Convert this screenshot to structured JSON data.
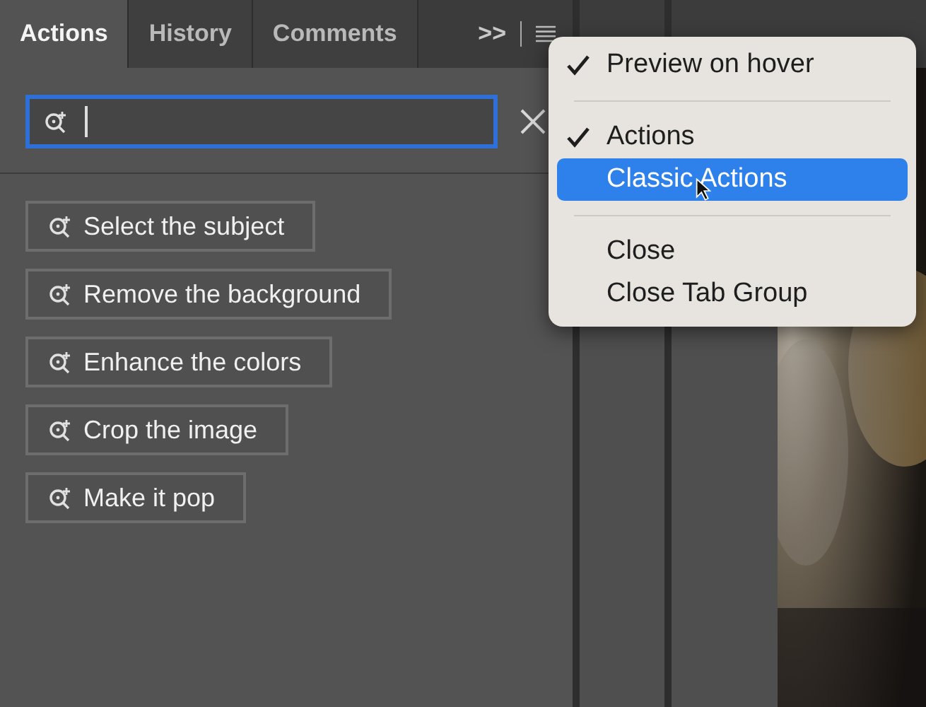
{
  "panel": {
    "tabs": [
      {
        "label": "Actions",
        "selected": true
      },
      {
        "label": "History",
        "selected": false
      },
      {
        "label": "Comments",
        "selected": false
      }
    ],
    "overflow": ">>",
    "search": {
      "focused": true
    },
    "actions": [
      "Select the subject",
      "Remove the background",
      "Enhance the colors",
      "Crop the image",
      "Make it pop"
    ]
  },
  "menu": {
    "items": [
      {
        "kind": "option",
        "label": "Preview on hover",
        "checked": true,
        "selected": false
      },
      {
        "kind": "separator"
      },
      {
        "kind": "option",
        "label": "Actions",
        "checked": true,
        "selected": false
      },
      {
        "kind": "option",
        "label": "Classic Actions",
        "checked": false,
        "selected": true
      },
      {
        "kind": "separator"
      },
      {
        "kind": "option",
        "label": "Close",
        "checked": false,
        "selected": false
      },
      {
        "kind": "option",
        "label": "Close Tab Group",
        "checked": false,
        "selected": false
      }
    ]
  }
}
